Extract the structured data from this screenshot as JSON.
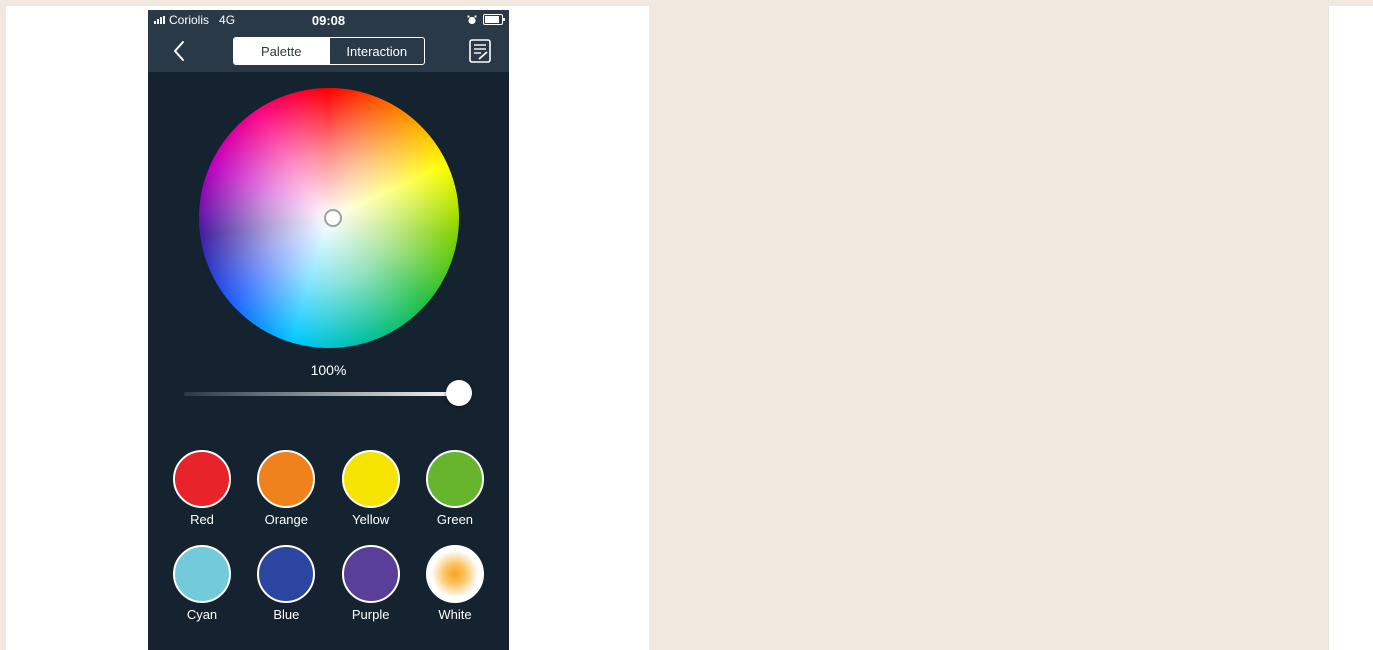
{
  "status_bar": {
    "carrier": "Coriolis",
    "network": "4G",
    "time": "09:08"
  },
  "nav": {
    "tabs": [
      {
        "label": "Palette",
        "active": true
      },
      {
        "label": "Interaction",
        "active": false
      }
    ]
  },
  "brightness": {
    "label": "100%",
    "value": 100
  },
  "swatches": [
    {
      "label": "Red",
      "color": "#e8242a"
    },
    {
      "label": "Orange",
      "color": "#f0821d"
    },
    {
      "label": "Yellow",
      "color": "#f5e400"
    },
    {
      "label": "Green",
      "color": "#66b52d"
    },
    {
      "label": "Cyan",
      "color": "#72cadb"
    },
    {
      "label": "Blue",
      "color": "#2b45a0"
    },
    {
      "label": "Purple",
      "color": "#5a3f99"
    },
    {
      "label": "White",
      "color": "#ffffff"
    }
  ],
  "colors": {
    "app_background": "#152331",
    "bar_background": "#2a3947",
    "page_beige": "#f1e8df"
  }
}
